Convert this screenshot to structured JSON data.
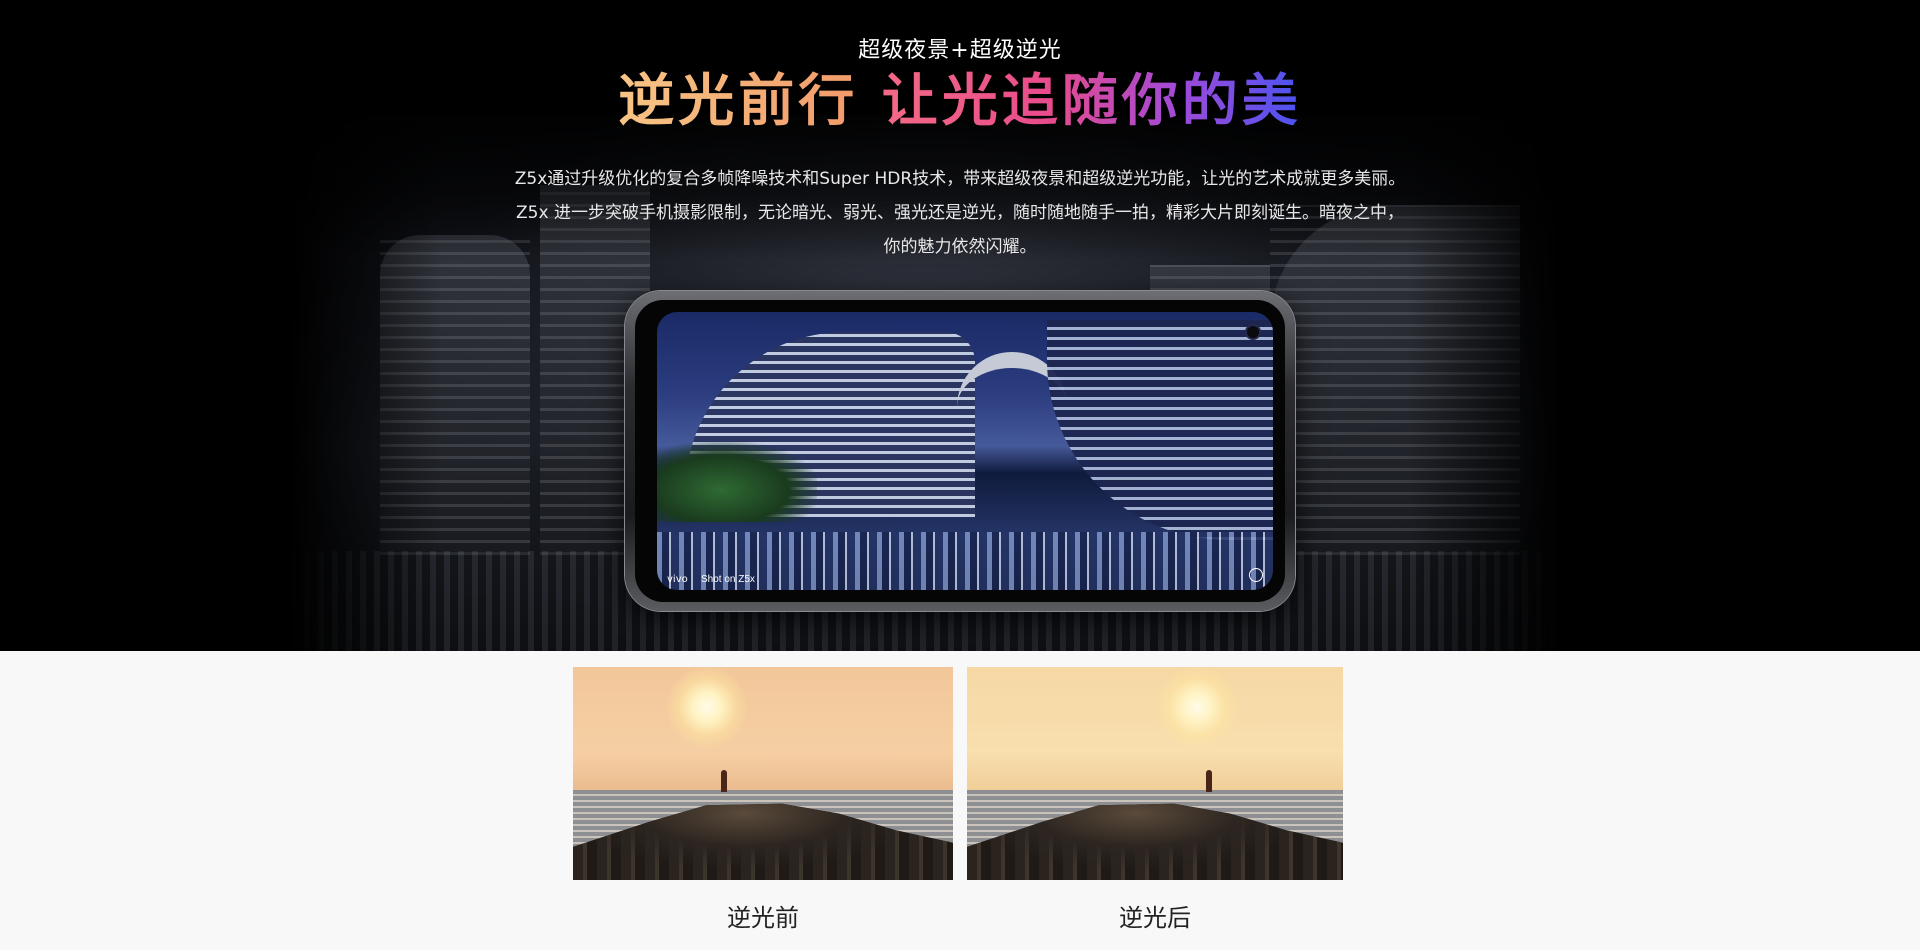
{
  "hero": {
    "subtitle": "超级夜景+超级逆光",
    "headline_part1": "逆光前行",
    "headline_part2": "让光追随你的美",
    "description_lines": [
      "Z5x通过升级优化的复合多帧降噪技术和Super HDR技术，带来超级夜景和超级逆光功能，让光的艺术成就更多美丽。",
      "Z5x 进一步突破手机摄影限制，无论暗光、弱光、强光还是逆光，随时随地随手一拍，精彩大片即刻诞生。暗夜之中，",
      "你的魅力依然闪耀。"
    ],
    "phone_watermark": "Shot on Z5x",
    "phone_logo": "vivo"
  },
  "comparison": {
    "before_label": "逆光前",
    "after_label": "逆光后"
  },
  "colors": {
    "gradient_start": "#f7c585",
    "gradient_pink": "#e84b8c",
    "gradient_purple": "#a14ad8",
    "gradient_blue": "#4a53f0"
  },
  "icons": [
    "camera-hole-icon",
    "settings-icon"
  ]
}
